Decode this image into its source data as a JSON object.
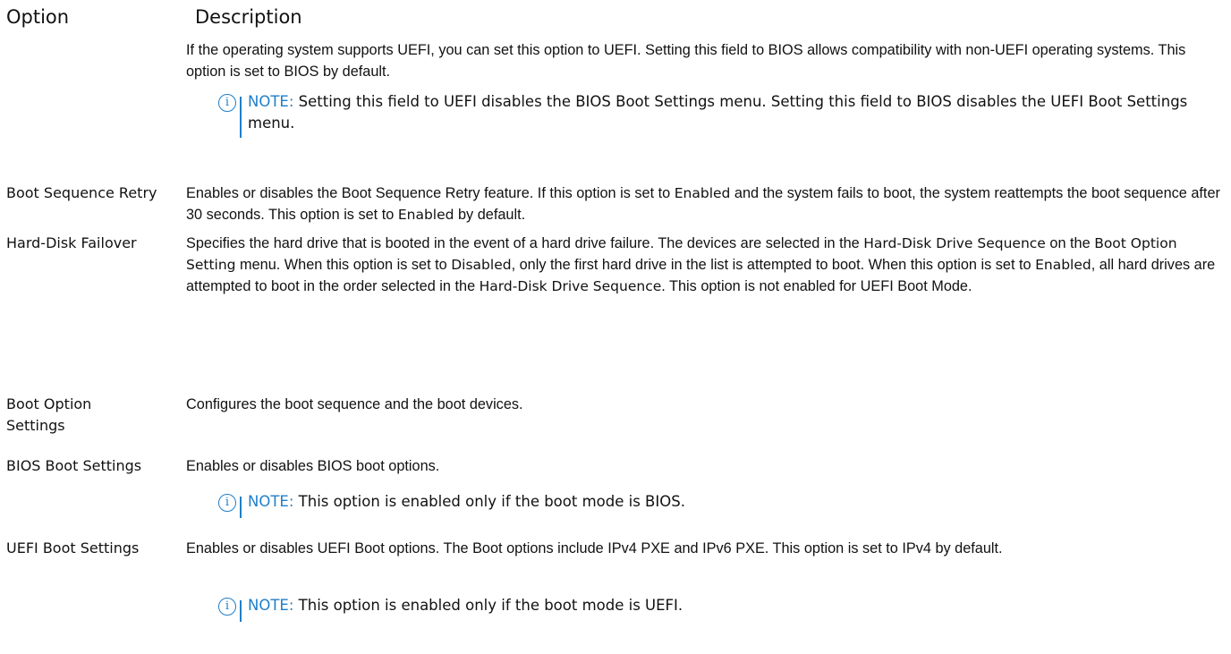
{
  "header": {
    "option": "Option",
    "description": "Description"
  },
  "rows": [
    {
      "label": "",
      "description": "If the operating system supports UEFI, you can set this option to UEFI. Setting this field to BIOS allows compatibility with non-UEFI operating systems. This option is set to BIOS by default.",
      "note": {
        "label": "NOTE:",
        "text": " Setting this field to UEFI disables the BIOS Boot Settings menu. Setting this field to BIOS disables the UEFI Boot Settings menu."
      }
    },
    {
      "label": "Boot Sequence Retry",
      "description_parts": [
        "Enables or disables the Boot Sequence Retry feature. If this option is set to ",
        "Enabled",
        " and the system fails to boot, the system reattempts the boot sequence after 30 seconds. This option is set to ",
        "Enabled",
        " by default."
      ]
    },
    {
      "label": "Hard-Disk Failover",
      "description_parts": [
        "Specifies the hard drive that is booted in the event of a hard drive failure. The devices are selected in the ",
        "Hard-Disk Drive Sequence",
        " on the ",
        "Boot Option Setting",
        " menu. When this option is set to ",
        "Disabled",
        ", only the first hard drive in the list is attempted to boot. When this option is set to ",
        "Enabled",
        ", all hard drives are attempted to boot in the order selected in the ",
        "Hard-Disk Drive Sequence",
        ". This option is not enabled for UEFI Boot Mode."
      ]
    },
    {
      "label": "Boot Option Settings",
      "description": "Configures the boot sequence and the boot devices."
    },
    {
      "label": "BIOS Boot Settings",
      "description": "Enables or disables BIOS boot options.",
      "note": {
        "label": "NOTE:",
        "text": " This option is enabled only if the boot mode is BIOS."
      }
    },
    {
      "label": "UEFI Boot Settings",
      "description": "Enables or disables UEFI Boot options. The Boot options include IPv4 PXE and IPv6 PXE. This option is set to IPv4 by default.",
      "note": {
        "label": "NOTE:",
        "text": " This option is enabled only if the boot mode is UEFI."
      }
    }
  ],
  "icons": {
    "note_icon": "info-icon"
  },
  "colors": {
    "note_accent": "#1f7fc9"
  }
}
